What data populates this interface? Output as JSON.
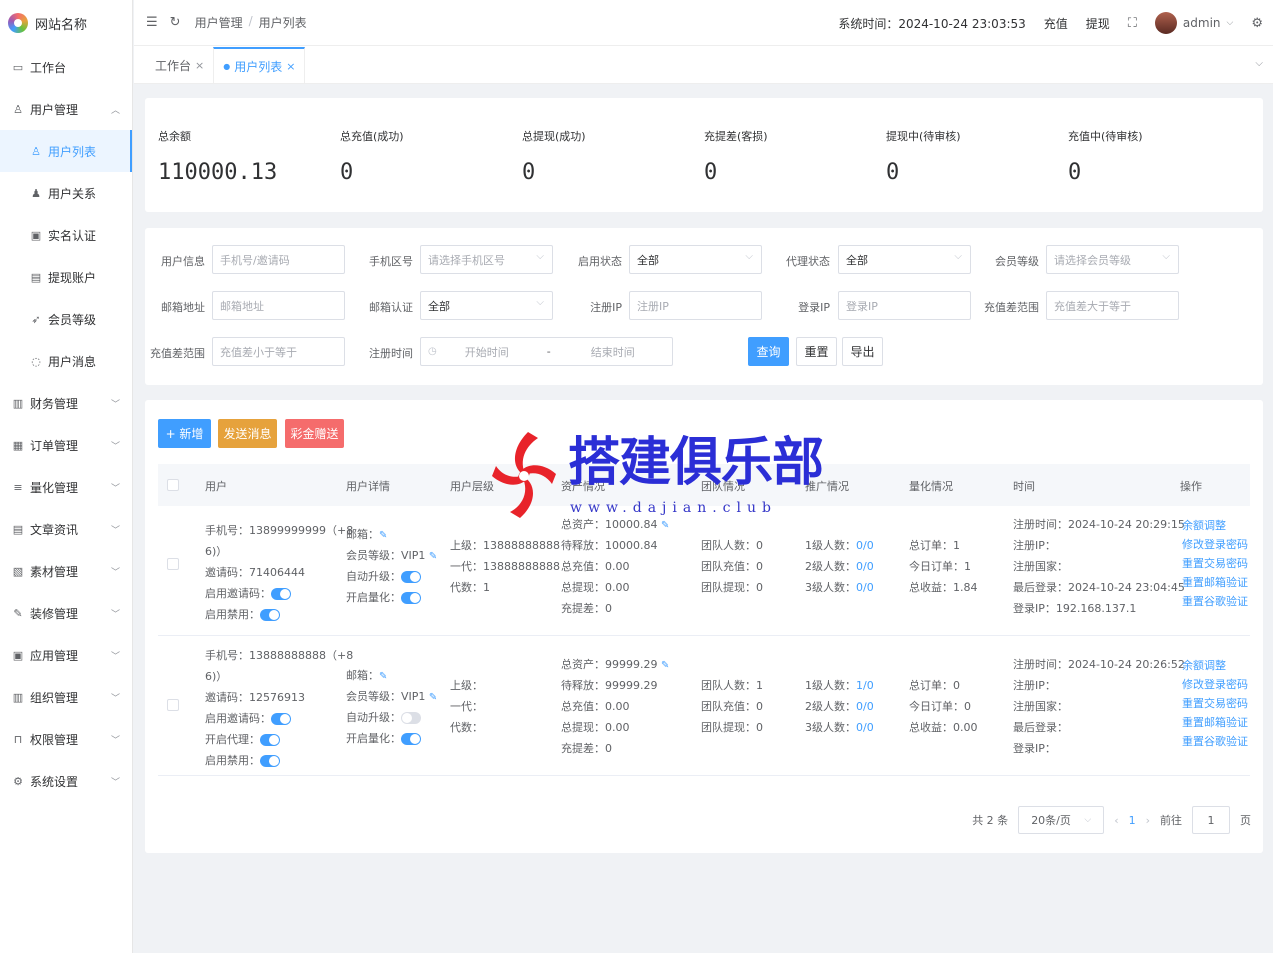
{
  "site": {
    "name": "网站名称"
  },
  "sidebar": {
    "items": [
      {
        "label": "工作台",
        "icon": "monitor-icon"
      },
      {
        "label": "用户管理",
        "icon": "user-icon",
        "expanded": true
      },
      {
        "label": "用户列表",
        "icon": "user-icon",
        "active": true
      },
      {
        "label": "用户关系",
        "icon": "users-icon"
      },
      {
        "label": "实名认证",
        "icon": "id-card-icon"
      },
      {
        "label": "提现账户",
        "icon": "wallet-icon"
      },
      {
        "label": "会员等级",
        "icon": "rocket-icon"
      },
      {
        "label": "用户消息",
        "icon": "message-icon"
      },
      {
        "label": "财务管理",
        "icon": "chart-icon"
      },
      {
        "label": "订单管理",
        "icon": "order-icon"
      },
      {
        "label": "量化管理",
        "icon": "sliders-icon"
      },
      {
        "label": "文章资讯",
        "icon": "article-icon"
      },
      {
        "label": "素材管理",
        "icon": "image-icon"
      },
      {
        "label": "装修管理",
        "icon": "brush-icon"
      },
      {
        "label": "应用管理",
        "icon": "app-icon"
      },
      {
        "label": "组织管理",
        "icon": "building-icon"
      },
      {
        "label": "权限管理",
        "icon": "lock-icon"
      },
      {
        "label": "系统设置",
        "icon": "gear-icon"
      }
    ]
  },
  "header": {
    "breadcrumb": [
      "用户管理",
      "用户列表"
    ],
    "system_time": "系统时间：2024-10-24 23:03:53",
    "recharge": "充值",
    "withdraw": "提现",
    "user": "admin"
  },
  "tabs": [
    {
      "label": "工作台"
    },
    {
      "label": "用户列表",
      "active": true
    }
  ],
  "stats": [
    {
      "label": "总余额",
      "value": "110000.13"
    },
    {
      "label": "总充值(成功)",
      "value": "0"
    },
    {
      "label": "总提现(成功)",
      "value": "0"
    },
    {
      "label": "充提差(客损)",
      "value": "0"
    },
    {
      "label": "提现中(待审核)",
      "value": "0"
    },
    {
      "label": "充值中(待审核)",
      "value": "0"
    }
  ],
  "filters": {
    "user_info": {
      "label": "用户信息",
      "placeholder": "手机号/邀请码"
    },
    "area_code": {
      "label": "手机区号",
      "placeholder": "请选择手机区号"
    },
    "enable_status": {
      "label": "启用状态",
      "value": "全部"
    },
    "agent_status": {
      "label": "代理状态",
      "value": "全部"
    },
    "member_level": {
      "label": "会员等级",
      "placeholder": "请选择会员等级"
    },
    "email": {
      "label": "邮箱地址",
      "placeholder": "邮箱地址"
    },
    "email_verify": {
      "label": "邮箱认证",
      "value": "全部"
    },
    "reg_ip": {
      "label": "注册IP",
      "placeholder": "注册IP"
    },
    "login_ip": {
      "label": "登录IP",
      "placeholder": "登录IP"
    },
    "diff_min": {
      "label": "充值差范围",
      "placeholder": "充值差大于等于"
    },
    "diff_max": {
      "label": "充值差范围",
      "placeholder": "充值差小于等于"
    },
    "reg_time": {
      "label": "注册时间",
      "start": "开始时间",
      "sep": "-",
      "end": "结束时间"
    },
    "buttons": {
      "search": "查询",
      "reset": "重置",
      "export": "导出"
    }
  },
  "actions": {
    "add": "+ 新增",
    "send_msg": "发送消息",
    "bonus": "彩金赠送"
  },
  "table": {
    "columns": [
      "用户",
      "用户详情",
      "用户层级",
      "资产情况",
      "团队情况",
      "推广情况",
      "量化情况",
      "时间",
      "操作"
    ],
    "rows": [
      {
        "user": {
          "phone": "手机号：13899999999（+8",
          "phone2": "6)）",
          "invite": "邀请码：71406444",
          "invite_label": "启用邀请码：",
          "invite_on": true,
          "agent_label": null,
          "ban_label": "启用禁用："
        },
        "detail": {
          "email": "邮箱：",
          "level": "会员等级：VIP1",
          "auto": "自动升级：",
          "auto_on": true,
          "quant": "开启量化：",
          "quant_on": true
        },
        "tier": {
          "up": "上级：13888888888",
          "first": "一代：13888888888",
          "gen": "代数：1"
        },
        "assets": [
          "总资产：10000.84",
          "待释放：10000.84",
          "总充值：0.00",
          "总提现：0.00",
          "充提差：0"
        ],
        "team": [
          "团队人数：0",
          "团队充值：0",
          "团队提现：0"
        ],
        "promo": [
          {
            "l": "1级人数：",
            "v": "0/0"
          },
          {
            "l": "2级人数：",
            "v": "0/0"
          },
          {
            "l": "3级人数：",
            "v": "0/0"
          }
        ],
        "quant": [
          "总订单：1",
          "今日订单：1",
          "总收益：1.84"
        ],
        "time": [
          "注册时间：2024-10-24 20:29:15",
          "注册IP：",
          "注册国家：",
          "最后登录：2024-10-24 23:04:45",
          "登录IP：192.168.137.1"
        ]
      },
      {
        "user": {
          "phone": "手机号：13888888888（+8",
          "phone2": "6)）",
          "invite": "邀请码：12576913",
          "invite_label": "启用邀请码：",
          "invite_on": true,
          "agent_label": "开启代理：",
          "ban_label": "启用禁用："
        },
        "detail": {
          "email": "邮箱：",
          "level": "会员等级：VIP1",
          "auto": "自动升级：",
          "auto_on": false,
          "quant": "开启量化：",
          "quant_on": true
        },
        "tier": {
          "up": "上级：",
          "first": "一代：",
          "gen": "代数："
        },
        "assets": [
          "总资产：99999.29",
          "待释放：99999.29",
          "总充值：0.00",
          "总提现：0.00",
          "充提差：0"
        ],
        "team": [
          "团队人数：1",
          "团队充值：0",
          "团队提现：0"
        ],
        "promo": [
          {
            "l": "1级人数：",
            "v": "1/0"
          },
          {
            "l": "2级人数：",
            "v": "0/0"
          },
          {
            "l": "3级人数：",
            "v": "0/0"
          }
        ],
        "quant": [
          "总订单：0",
          "今日订单：0",
          "总收益：0.00"
        ],
        "time": [
          "注册时间：2024-10-24 20:26:52",
          "注册IP：",
          "注册国家：",
          "最后登录：",
          "登录IP："
        ]
      }
    ],
    "ops": [
      "余额调整",
      "修改登录密码",
      "重置交易密码",
      "重置邮箱验证",
      "重置谷歌验证"
    ]
  },
  "pagination": {
    "total": "共 2 条",
    "size": "20条/页",
    "page": "1",
    "goto": "前往",
    "goto_value": "1",
    "unit": "页"
  },
  "watermark": {
    "title": "搭建俱乐部",
    "url": "www.dajian.club"
  },
  "colors": {
    "primary": "#409eff",
    "warning": "#e6a23c",
    "danger": "#f56c6c",
    "watermark": "#2b2ed6"
  }
}
